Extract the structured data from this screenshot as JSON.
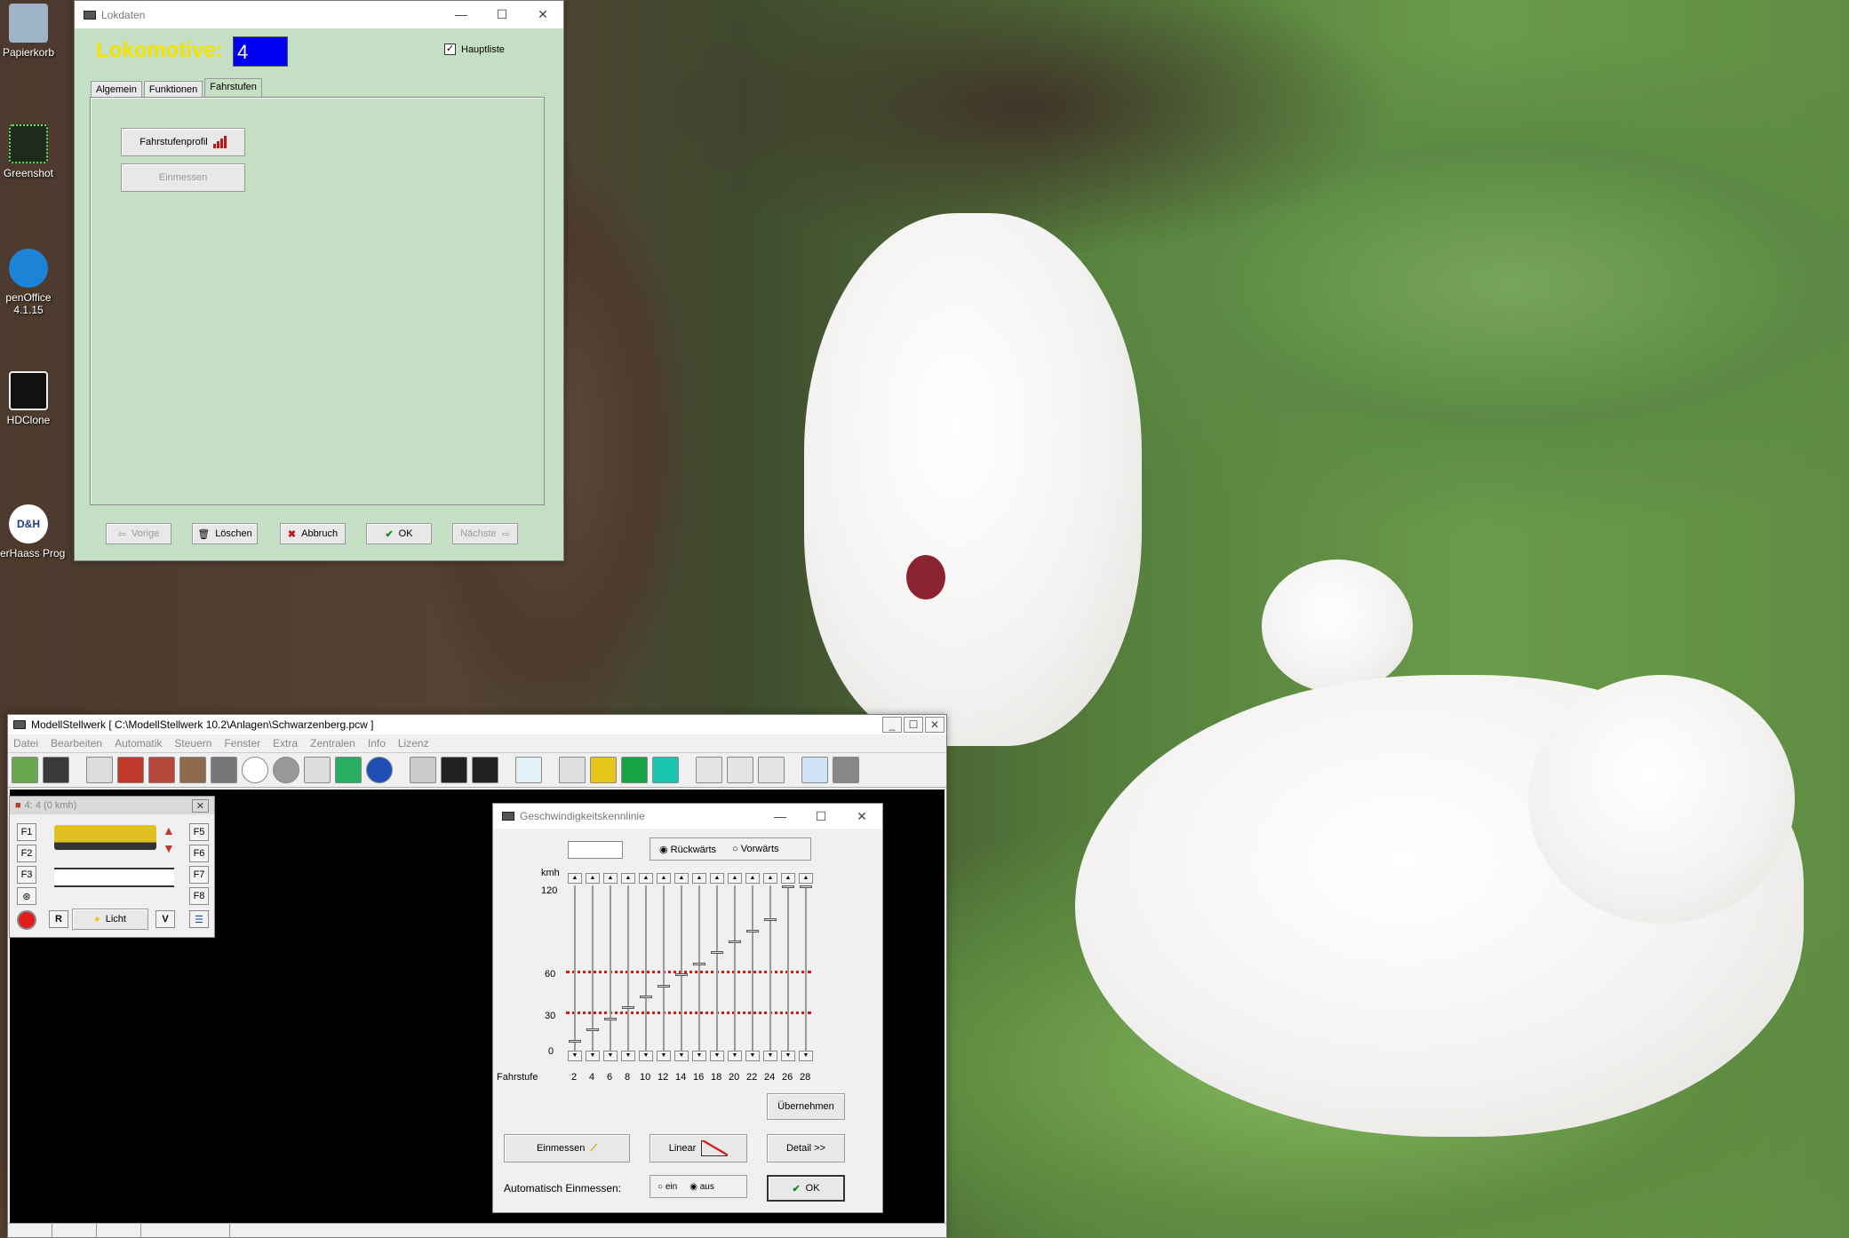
{
  "desktop": {
    "icons": [
      {
        "label": "Papierkorb",
        "name": "recycle-bin-icon"
      },
      {
        "label": "Greenshot",
        "name": "greenshot-icon"
      },
      {
        "label": "penOffice 4.1.15",
        "name": "openoffice-icon"
      },
      {
        "label": "HDClone",
        "name": "hdclone-icon"
      },
      {
        "label": "hlerHaass Prog",
        "name": "dh-icon"
      }
    ]
  },
  "lokdaten": {
    "title": "Lokdaten",
    "heading": "Lokomotive:",
    "loco_number": "4",
    "hauptliste_label": "Hauptliste",
    "hauptliste_checked": true,
    "tabs": [
      "Algemein",
      "Funktionen",
      "Fahrstufen"
    ],
    "active_tab": "Fahrstufen",
    "fahrstufenprofil_label": "Fahrstufenprofil",
    "einmessen_label": "Einmessen",
    "footer": {
      "vorige": "Vorige",
      "loeschen": "Löschen",
      "abbruch": "Abbruch",
      "ok": "OK",
      "naechste": "Nächste"
    }
  },
  "main": {
    "title": "ModellStellwerk [ C:\\ModellStellwerk 10.2\\Anlagen\\Schwarzenberg.pcw ]",
    "menu": [
      "Datei",
      "Bearbeiten",
      "Automatik",
      "Steuern",
      "Fenster",
      "Extra",
      "Zentralen",
      "Info",
      "Lizenz"
    ]
  },
  "loco_control": {
    "title": "4: 4 (0 kmh)",
    "left_buttons": [
      "F1",
      "F2",
      "F3"
    ],
    "right_buttons": [
      "F5",
      "F6",
      "F7",
      "F8"
    ],
    "r_label": "R",
    "v_label": "V",
    "licht_label": "Licht"
  },
  "geschwindigkeit": {
    "title": "Geschwindigkeitskennlinie",
    "direction_options": [
      "Rückwärts",
      "Vorwärts"
    ],
    "direction_selected": "Rückwärts",
    "unit": "kmh",
    "y_ticks": [
      "120",
      "60",
      "30",
      "0"
    ],
    "x_label": "Fahrstufe",
    "x_ticks": [
      "2",
      "4",
      "6",
      "8",
      "10",
      "12",
      "14",
      "16",
      "18",
      "20",
      "22",
      "24",
      "26",
      "28"
    ],
    "slider_values_kmh": [
      8,
      16,
      24,
      32,
      40,
      48,
      56,
      64,
      72,
      80,
      88,
      96,
      120,
      120
    ],
    "buttons": {
      "uebernehmen": "Übernehmen",
      "einmessen": "Einmessen",
      "linear": "Linear",
      "detail": "Detail >>",
      "ok": "OK"
    },
    "auto_label": "Automatisch Einmessen:",
    "auto_options": [
      "ein",
      "aus"
    ],
    "auto_selected": "aus"
  }
}
